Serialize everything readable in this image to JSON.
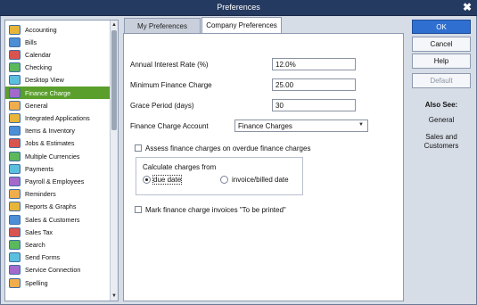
{
  "window": {
    "title": "Preferences",
    "close_glyph": "✖"
  },
  "sidebar": {
    "items": [
      {
        "label": "Accounting",
        "icon": "accounting-icon"
      },
      {
        "label": "Bills",
        "icon": "bills-icon"
      },
      {
        "label": "Calendar",
        "icon": "calendar-icon"
      },
      {
        "label": "Checking",
        "icon": "checking-icon"
      },
      {
        "label": "Desktop View",
        "icon": "desktop-view-icon"
      },
      {
        "label": "Finance Charge",
        "icon": "finance-charge-icon",
        "selected": true
      },
      {
        "label": "General",
        "icon": "general-icon"
      },
      {
        "label": "Integrated Applications",
        "icon": "integrated-applications-icon"
      },
      {
        "label": "Items & Inventory",
        "icon": "items-inventory-icon"
      },
      {
        "label": "Jobs & Estimates",
        "icon": "jobs-estimates-icon"
      },
      {
        "label": "Multiple Currencies",
        "icon": "multiple-currencies-icon"
      },
      {
        "label": "Payments",
        "icon": "payments-icon"
      },
      {
        "label": "Payroll & Employees",
        "icon": "payroll-employees-icon"
      },
      {
        "label": "Reminders",
        "icon": "reminders-icon"
      },
      {
        "label": "Reports & Graphs",
        "icon": "reports-graphs-icon"
      },
      {
        "label": "Sales & Customers",
        "icon": "sales-customers-icon"
      },
      {
        "label": "Sales Tax",
        "icon": "sales-tax-icon"
      },
      {
        "label": "Search",
        "icon": "search-icon"
      },
      {
        "label": "Send Forms",
        "icon": "send-forms-icon"
      },
      {
        "label": "Service Connection",
        "icon": "service-connection-icon"
      },
      {
        "label": "Spelling",
        "icon": "spelling-icon"
      }
    ],
    "scroll_up_glyph": "▲",
    "scroll_down_glyph": "▼"
  },
  "tabs": {
    "my": "My Preferences",
    "company": "Company Preferences"
  },
  "form": {
    "interest_label": "Annual Interest Rate (%)",
    "interest_value": "12.0%",
    "min_charge_label": "Minimum Finance Charge",
    "min_charge_value": "25.00",
    "grace_label": "Grace Period (days)",
    "grace_value": "30",
    "account_label": "Finance Charge Account",
    "account_value": "Finance Charges",
    "assess_label": "Assess finance charges on overdue finance charges",
    "calc_label": "Calculate charges from",
    "due_date_label": "due date",
    "invoice_date_label": "invoice/billed date",
    "mark_label": "Mark finance charge invoices \"To be printed\""
  },
  "buttons": {
    "ok": "OK",
    "cancel": "Cancel",
    "help": "Help",
    "default": "Default"
  },
  "also_see": {
    "heading": "Also See:",
    "general": "General",
    "sales_line1": "Sales and",
    "sales_line2": "Customers"
  },
  "colors": {
    "titlebar": "#253a60",
    "selected": "#5a9f2c",
    "ok_button": "#2f6fd0"
  }
}
